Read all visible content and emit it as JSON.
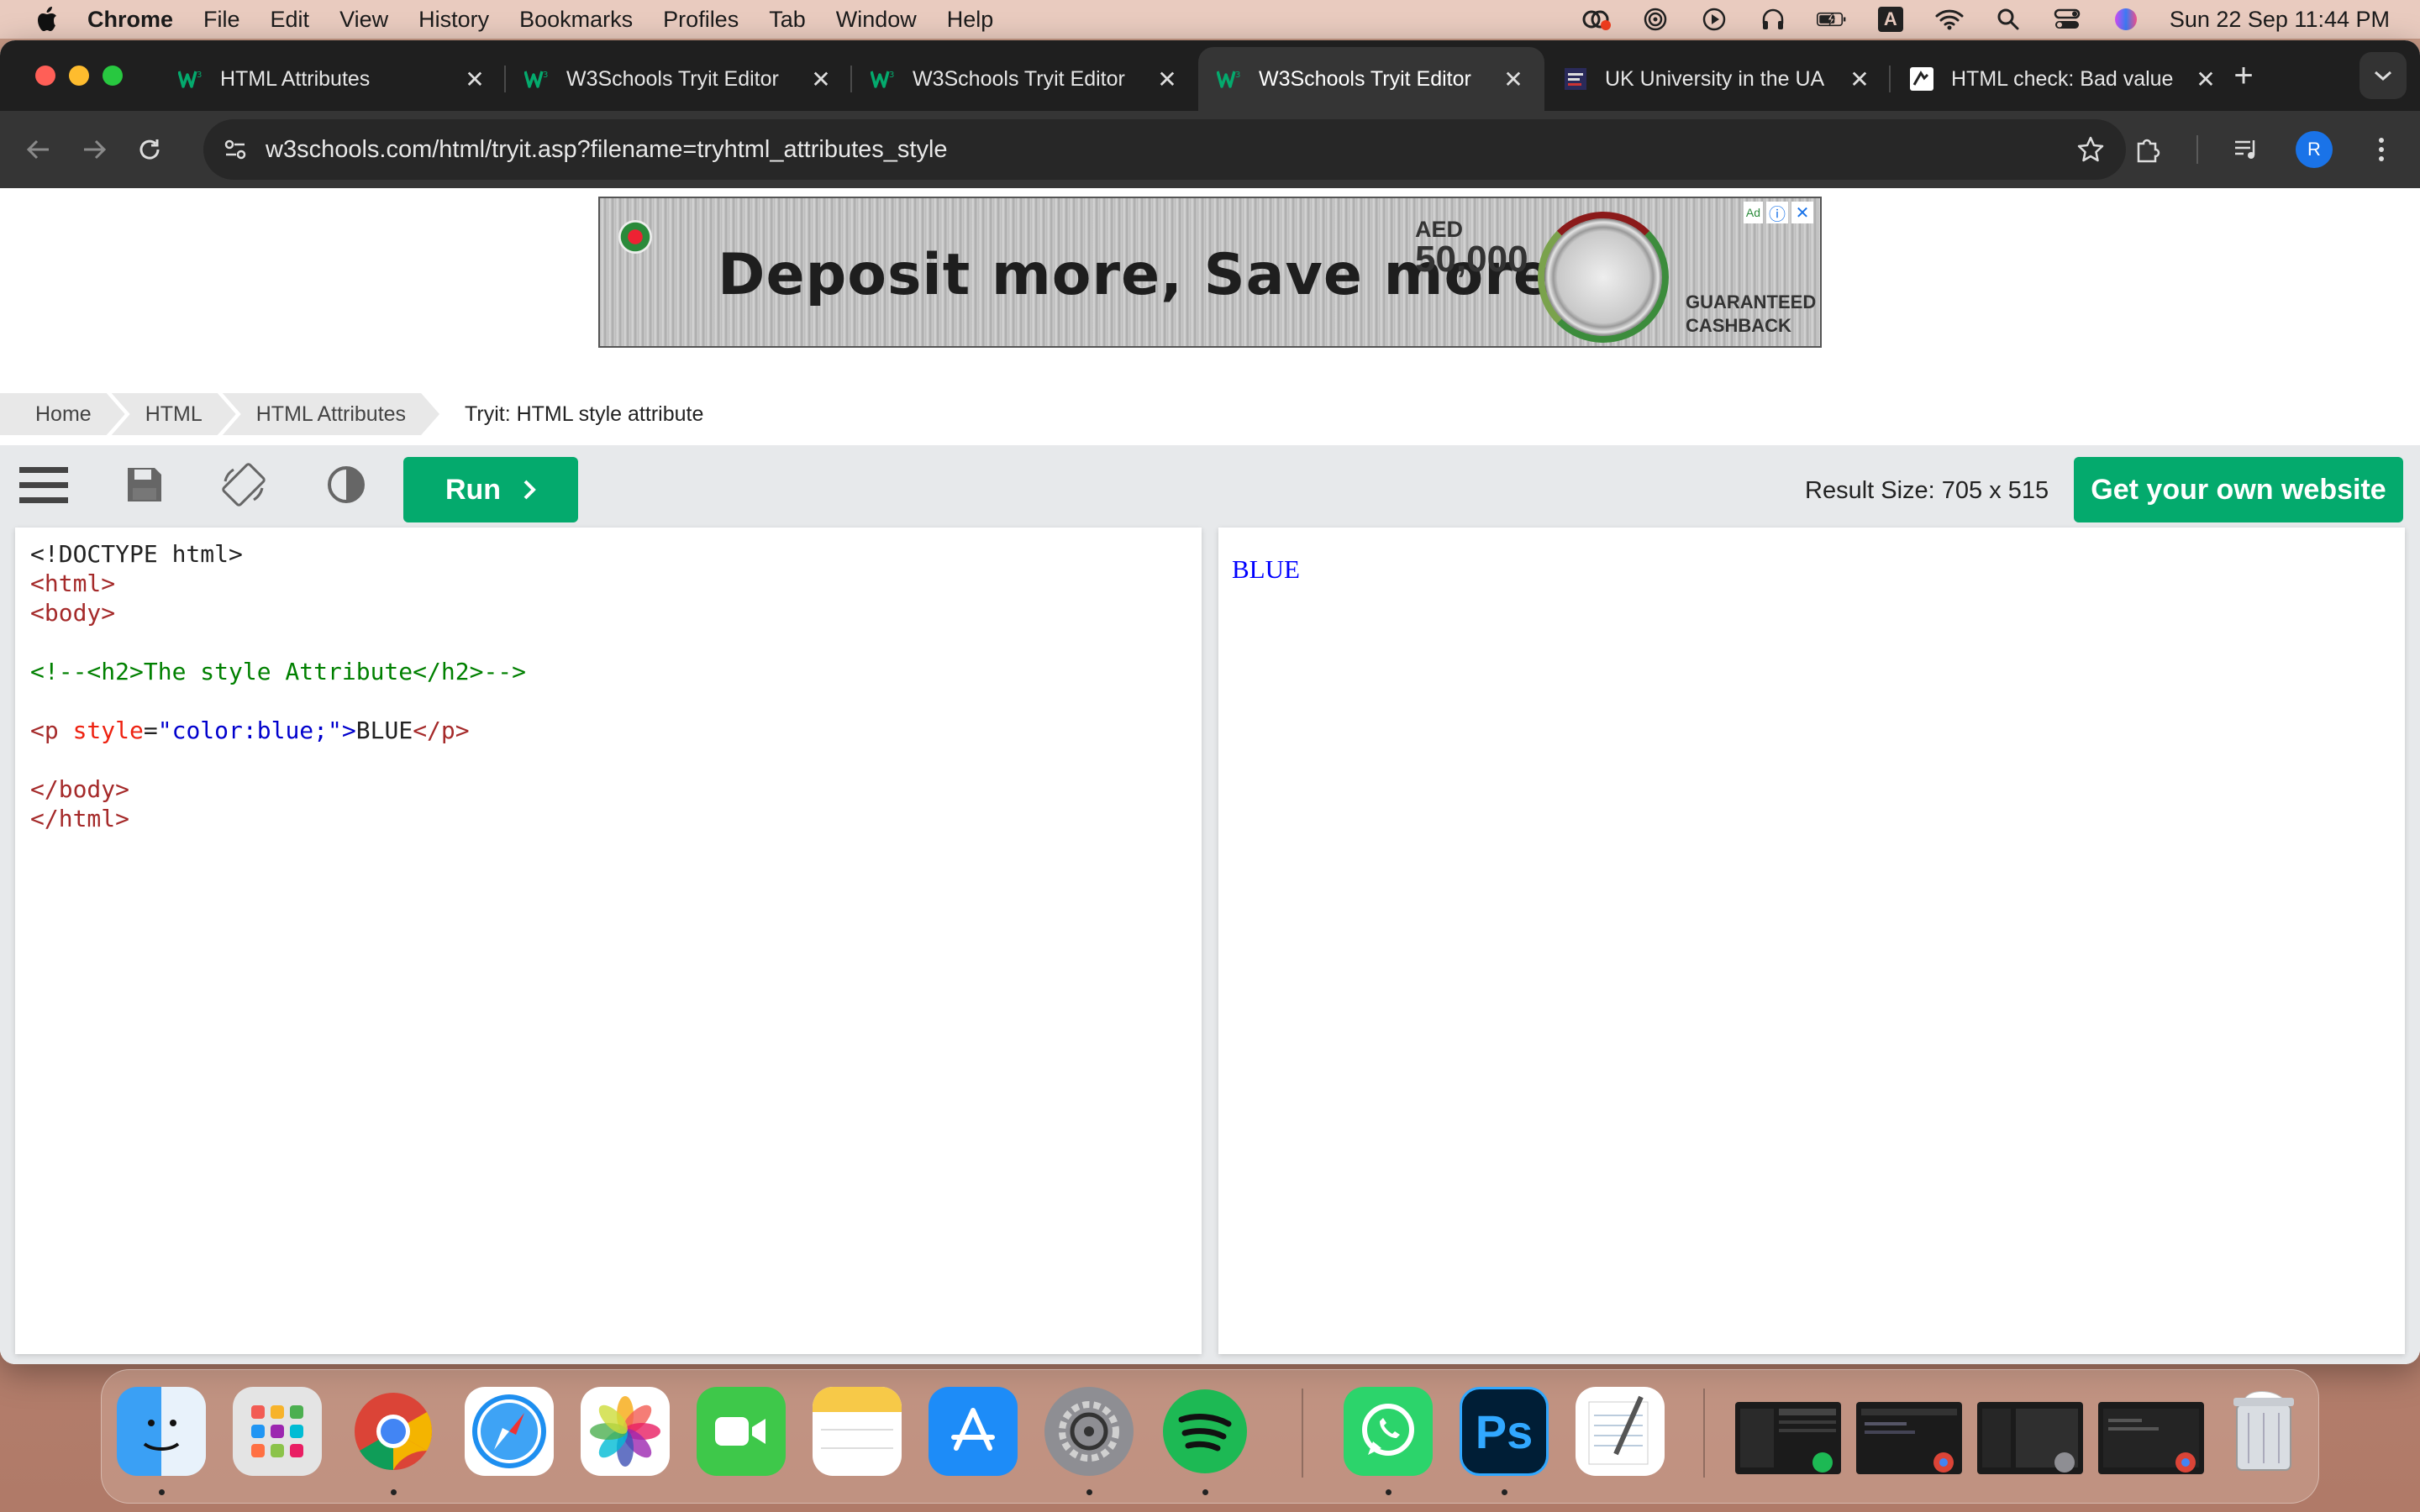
{
  "menubar": {
    "app_name": "Chrome",
    "items": [
      "File",
      "Edit",
      "View",
      "History",
      "Bookmarks",
      "Profiles",
      "Tab",
      "Window",
      "Help"
    ],
    "status_icons": [
      "creative-cloud-icon",
      "airdrop-icon",
      "play-icon",
      "headphones-icon",
      "battery-icon",
      "input-source-icon",
      "wifi-icon",
      "spotlight-icon",
      "control-center-icon",
      "siri-icon"
    ],
    "input_source_letter": "A",
    "clock": "Sun 22 Sep  11:44 PM"
  },
  "tabs": [
    {
      "title": "HTML Attributes",
      "icon": "w3schools-icon",
      "active": false
    },
    {
      "title": "W3Schools Tryit Editor",
      "icon": "w3schools-icon",
      "active": false
    },
    {
      "title": "W3Schools Tryit Editor",
      "icon": "w3schools-icon",
      "active": false
    },
    {
      "title": "W3Schools Tryit Editor",
      "icon": "w3schools-icon",
      "active": true
    },
    {
      "title": "UK University in the UA",
      "icon": "bath-spa-icon",
      "active": false
    },
    {
      "title": "HTML check: Bad value",
      "icon": "validator-icon",
      "active": false
    }
  ],
  "toolbar": {
    "url": "w3schools.com/html/tryit.asp?filename=tryhtml_attributes_style",
    "profile_initial": "R"
  },
  "ad": {
    "headline": "Deposit more, Save more.",
    "currency": "AED",
    "amount": "50,000",
    "tagline_1": "GUARANTEED",
    "tagline_2": "CASHBACK",
    "ad_badge": "Ad"
  },
  "breadcrumb": [
    "Home",
    "HTML",
    "HTML Attributes",
    "Tryit: HTML style attribute"
  ],
  "editor": {
    "run_label": "Run",
    "result_size": "Result Size: 705 x 515",
    "own_website_label": "Get your own website"
  },
  "code": {
    "line1": "<!DOCTYPE html>",
    "line2": "<html>",
    "line3": "<body>",
    "line4": "<!--<h2>The style Attribute</h2>-->",
    "line5_open": "<p",
    "line5_attr": "style",
    "line5_eq": "=",
    "line5_val": "\"color:blue;\"",
    "line5_close": ">",
    "line5_text": "BLUE",
    "line5_end": "</p>",
    "line6": "</body>",
    "line7": "</html>"
  },
  "result": {
    "output_text": "BLUE"
  },
  "colors": {
    "w3_green": "#04aa6d",
    "result_blue": "#0000ff",
    "tab_bg": "#1f1f1f"
  },
  "dock": [
    "Finder",
    "Launchpad",
    "Chrome",
    "Safari",
    "Photos",
    "FaceTime",
    "Notes",
    "App Store",
    "System Settings",
    "Spotify",
    "WhatsApp",
    "Photoshop",
    "TextEdit",
    "Trash"
  ]
}
